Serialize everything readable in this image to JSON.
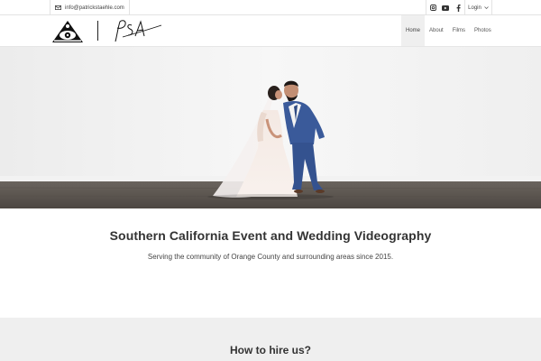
{
  "topbar": {
    "email": "info@patrickstaehle.com",
    "email_icon": "envelope-icon",
    "social": [
      "instagram-icon",
      "youtube-icon",
      "facebook-icon"
    ],
    "login_label": "Login"
  },
  "header": {
    "logo_icon": "triangle-eye-logo",
    "signature_icon": "psa-signature-logo",
    "nav": [
      "Home",
      "About",
      "Films",
      "Photos"
    ],
    "active_nav": "Home"
  },
  "hero": {
    "image": "bride-and-groom-photo"
  },
  "intro": {
    "title": "Southern California Event and Wedding Videography",
    "subtitle": "Serving the community of Orange County and surrounding areas since 2015."
  },
  "hire": {
    "heading": "How to hire us?"
  },
  "colors": {
    "text": "#333333",
    "nav_active_bg": "#efefef",
    "hire_bg": "#efefef",
    "floor": "#5b5550"
  }
}
